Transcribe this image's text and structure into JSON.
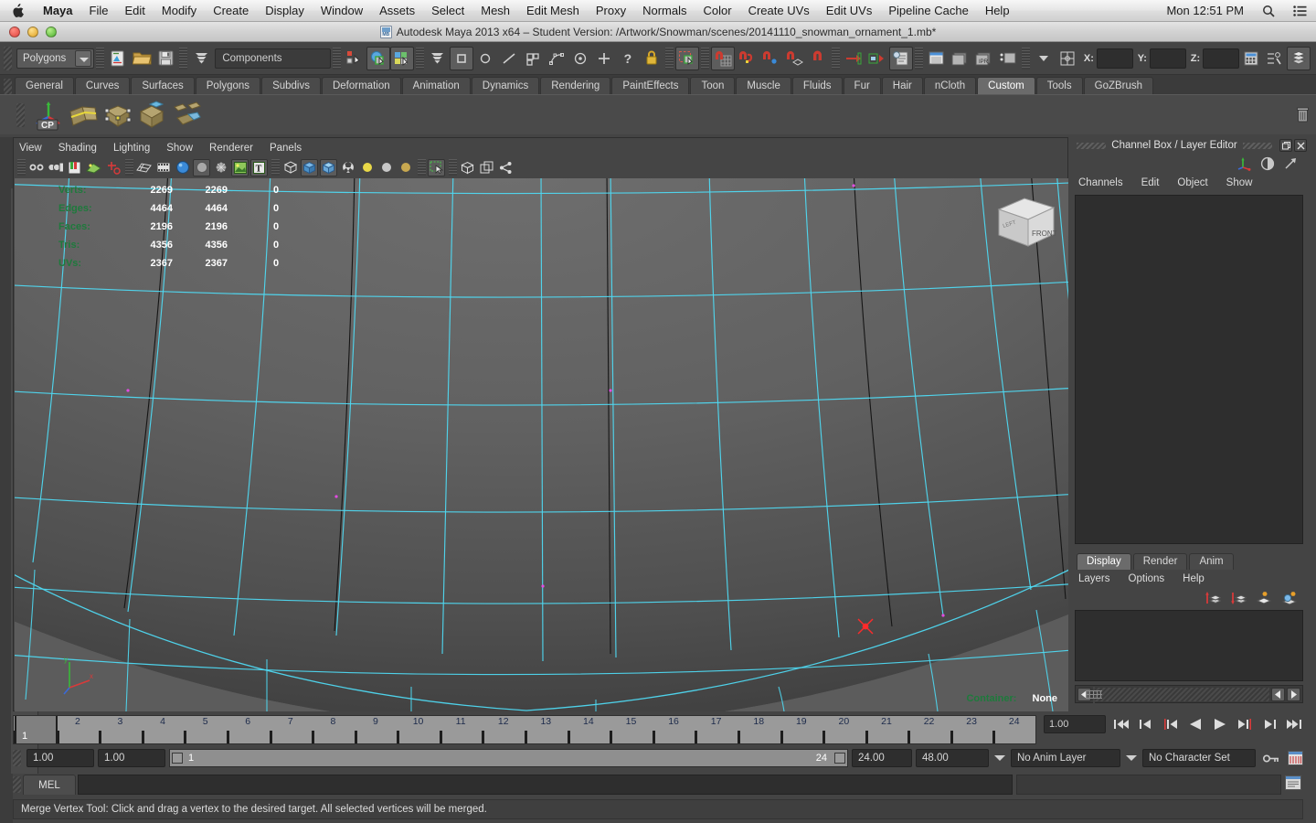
{
  "osx_menu": {
    "apple": "apple-logo",
    "items": [
      "Maya",
      "File",
      "Edit",
      "Modify",
      "Create",
      "Display",
      "Window",
      "Assets",
      "Select",
      "Mesh",
      "Edit Mesh",
      "Proxy",
      "Normals",
      "Color",
      "Create UVs",
      "Edit UVs",
      "Pipeline Cache",
      "Help"
    ],
    "clock": "Mon 12:51 PM",
    "search_icon": "search-icon",
    "menu_icon": "list-icon"
  },
  "window": {
    "title": "Autodesk Maya 2013 x64 – Student Version: /Artwork/Snowman/scenes/20141110_snowman_ornament_1.mb*"
  },
  "statusline": {
    "mode": "Polygons",
    "components_field": "Components",
    "coord_labels": [
      "X:",
      "Y:",
      "Z:"
    ],
    "coord_values": [
      "",
      "",
      ""
    ]
  },
  "shelf": {
    "tabs": [
      "General",
      "Curves",
      "Surfaces",
      "Polygons",
      "Subdivs",
      "Deformation",
      "Animation",
      "Dynamics",
      "Rendering",
      "PaintEffects",
      "Toon",
      "Muscle",
      "Fluids",
      "Fur",
      "Hair",
      "nCloth",
      "Custom",
      "Tools",
      "GoZBrush"
    ],
    "active_tab": "Custom",
    "buttons": [
      "cp-tool-icon",
      "poly-split-icon",
      "poly-merge-icon",
      "poly-extrude-icon",
      "poly-bevel-icon"
    ],
    "cp_label": "CP"
  },
  "viewport": {
    "menus": [
      "View",
      "Shading",
      "Lighting",
      "Show",
      "Renderer",
      "Panels"
    ],
    "hud_rows": [
      {
        "label": "Verts:",
        "v1": "2269",
        "v2": "2269",
        "v3": "0"
      },
      {
        "label": "Edges:",
        "v1": "4464",
        "v2": "4464",
        "v3": "0"
      },
      {
        "label": "Faces:",
        "v1": "2196",
        "v2": "2196",
        "v3": "0"
      },
      {
        "label": "Tris:",
        "v1": "4356",
        "v2": "4356",
        "v3": "0"
      },
      {
        "label": "UVs:",
        "v1": "2367",
        "v2": "2367",
        "v3": "0"
      }
    ],
    "container_label": "Container:",
    "container_value": "None",
    "viewcube_face": "FRONT",
    "axis_x": "x",
    "axis_y": "y",
    "axis_z": "z"
  },
  "channel_box": {
    "title": "Channel Box / Layer Editor",
    "menus": [
      "Channels",
      "Edit",
      "Object",
      "Show"
    ],
    "restore_icon": "restore-icon",
    "close_icon": "close-icon",
    "toolbar_icons": [
      "channel-box-icon",
      "attribute-editor-icon",
      "tool-settings-icon"
    ]
  },
  "layer_editor": {
    "tabs": [
      "Display",
      "Render",
      "Anim"
    ],
    "active_tab": "Display",
    "menus": [
      "Layers",
      "Options",
      "Help"
    ],
    "icons": [
      "new-layer-up-icon",
      "new-layer-down-icon",
      "new-layer-icon",
      "new-layer-selected-icon"
    ]
  },
  "timeline": {
    "ticks": [
      "1",
      "2",
      "3",
      "4",
      "5",
      "6",
      "7",
      "8",
      "9",
      "10",
      "11",
      "12",
      "13",
      "14",
      "15",
      "16",
      "17",
      "18",
      "19",
      "20",
      "21",
      "22",
      "23",
      "24"
    ],
    "current_frame": "1",
    "current_field": "1.00",
    "playback_icons": [
      "go-to-start",
      "step-back-key",
      "step-back-frame",
      "play-backwards",
      "play-forwards",
      "step-forward-frame",
      "step-forward-key",
      "go-to-end"
    ]
  },
  "range": {
    "anim_start": "1.00",
    "range_start": "1.00",
    "bar_start": "1",
    "bar_end": "24",
    "range_end": "24.00",
    "anim_end": "48.00",
    "anim_layer": "No Anim Layer",
    "character_set": "No Character Set",
    "key_icon": "key-icon",
    "auto_key_icon": "auto-keyframe-icon",
    "prefs_icon": "animation-preferences-icon"
  },
  "command_line": {
    "tab": "MEL",
    "input": ""
  },
  "help_line": {
    "text": "Merge Vertex Tool: Click and drag a vertex to the desired target. All selected vertices will be merged."
  },
  "colors": {
    "hud_green": "#1e7a3c",
    "wire_cyan": "#45d8f5",
    "bg_panel": "#444444",
    "viewport_bg": "#5c5c5c"
  }
}
